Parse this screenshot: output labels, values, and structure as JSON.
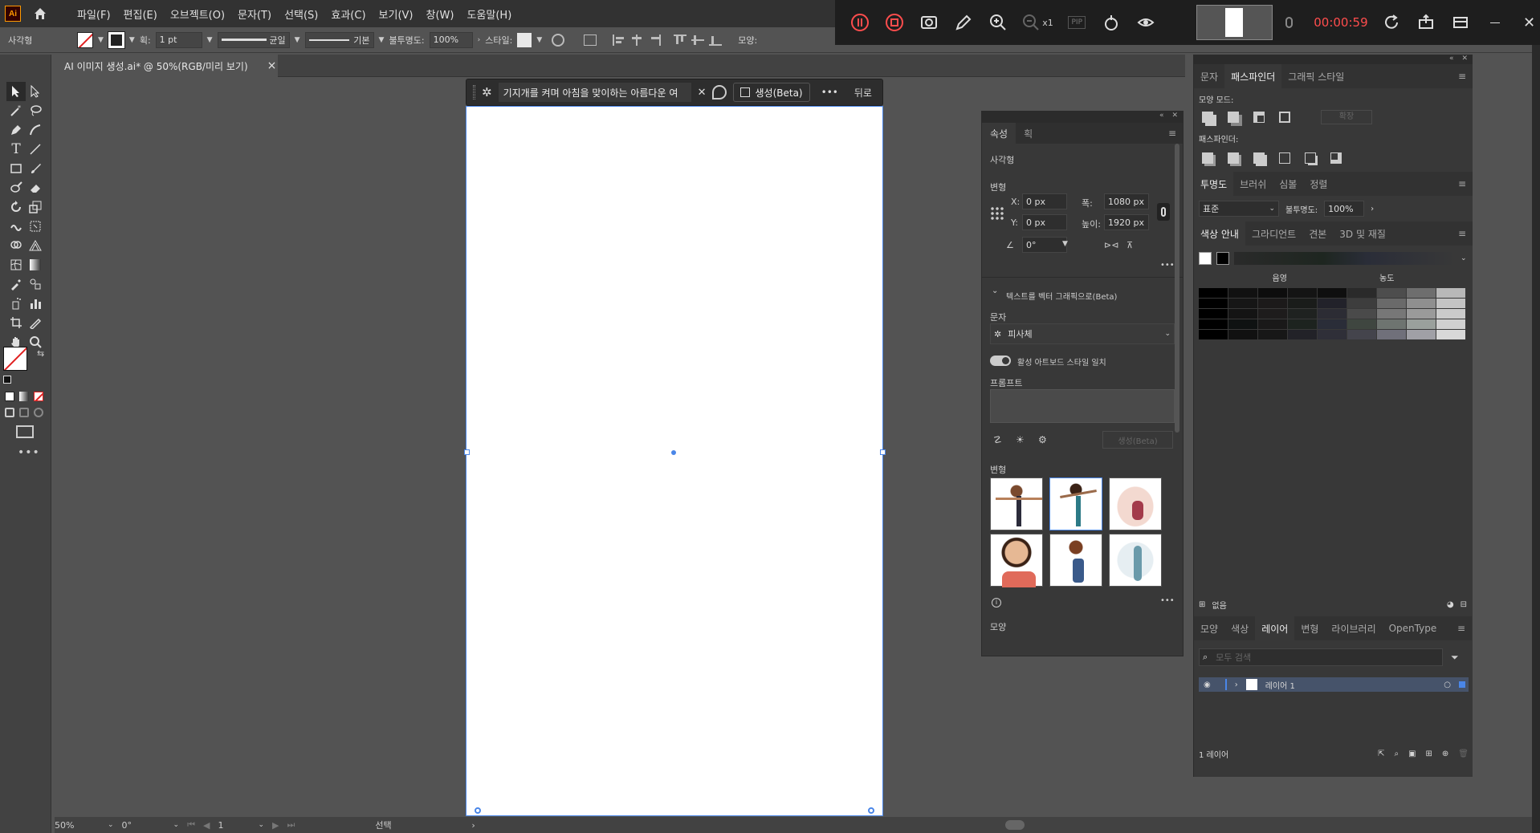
{
  "app": {
    "logo": "Ai",
    "home_icon": "home-icon"
  },
  "menu": [
    "파일(F)",
    "편집(E)",
    "오브젝트(O)",
    "문자(T)",
    "선택(S)",
    "효과(C)",
    "보기(V)",
    "창(W)",
    "도움말(H)"
  ],
  "control_bar": {
    "object_type": "사각형",
    "stroke_weight_label": "획:",
    "stroke_weight": "1 pt",
    "stroke_profile": "균일",
    "brush": "기본",
    "opacity_label": "불투명도:",
    "opacity": "100%",
    "style_label": "스타일:",
    "shape_label": "모양:"
  },
  "recording": {
    "timer": "00:00:59",
    "zoom_label": "x1",
    "pip_label": "PIP"
  },
  "document_tab": {
    "title": "AI 이미지 생성.ai* @ 50%(RGB/미리 보기)",
    "close": "×"
  },
  "task_bar": {
    "prompt": "기지개를 켜며 아침을 맞이하는 아름다운 여",
    "generate": "생성(Beta)",
    "more": "•••",
    "back": "뒤로"
  },
  "properties_panel": {
    "tabs": [
      "속성",
      "획"
    ],
    "object": "사각형",
    "transform_title": "변형",
    "x_label": "X:",
    "x": "0 px",
    "y_label": "Y:",
    "y": "0 px",
    "w_label": "폭:",
    "w": "1080 px",
    "h_label": "높이:",
    "h": "1920 px",
    "angle": "0°",
    "t2v_title": "텍스트를 벡터 그래픽으로(Beta)",
    "type_label": "문자",
    "type_value": "피사체",
    "toggle_label": "활성 아트보드 스타일 일치",
    "prompt_label": "프롬프트",
    "generate_disabled": "생성(Beta)",
    "variations_label": "변형",
    "appearance_label": "모양"
  },
  "pathfinder": {
    "tabs": [
      "문자",
      "패스파인더",
      "그래픽 스타일"
    ],
    "shape_modes": "모양 모드:",
    "expand": "확장",
    "pathfinders": "패스파인더:"
  },
  "transparency": {
    "tabs": [
      "투명도",
      "브러쉬",
      "심볼",
      "정렬"
    ],
    "blend": "표준",
    "opacity_label": "불투명도:",
    "opacity": "100%"
  },
  "color_guide": {
    "tabs": [
      "색상 안내",
      "그라디언트",
      "견본",
      "3D 및 재질"
    ],
    "shade_label": "음영",
    "tint_label": "농도",
    "footer": "없음",
    "swatches": [
      [
        "#000000",
        "#111111",
        "#0d0d0d",
        "#141414",
        "#0f0f0f",
        "#2a2a2a",
        "#4d4d4d",
        "#6e6e6e",
        "#b8b8b8"
      ],
      [
        "#000000",
        "#161616",
        "#1c1a1a",
        "#1a1c1a",
        "#22222a",
        "#3d3d3d",
        "#6a6a6a",
        "#8f8f8f",
        "#c4c4c4"
      ],
      [
        "#000000",
        "#141414",
        "#1e1c1c",
        "#1f2220",
        "#2c2c34",
        "#4a4a4a",
        "#777777",
        "#9a9a9a",
        "#cbcbcb"
      ],
      [
        "#000000",
        "#0f1212",
        "#1a1919",
        "#1d231f",
        "#2a2d38",
        "#3f4640",
        "#6e7470",
        "#9aa09c",
        "#d0d0d0"
      ],
      [
        "#000000",
        "#111111",
        "#171717",
        "#222228",
        "#2f2f38",
        "#44444c",
        "#70707a",
        "#a0a0a6",
        "#d8d8d8"
      ]
    ]
  },
  "layers": {
    "tabs": [
      "모양",
      "색상",
      "레이어",
      "변형",
      "라이브러리",
      "OpenType"
    ],
    "search_placeholder": "모두 검색",
    "layer_name": "레이어 1",
    "footer": "1 레이어"
  },
  "status": {
    "zoom": "50%",
    "angle": "0°",
    "page": "1",
    "tool": "선택"
  },
  "colors": {
    "accent": "#4a86e8",
    "timer": "#ff4d4d"
  }
}
